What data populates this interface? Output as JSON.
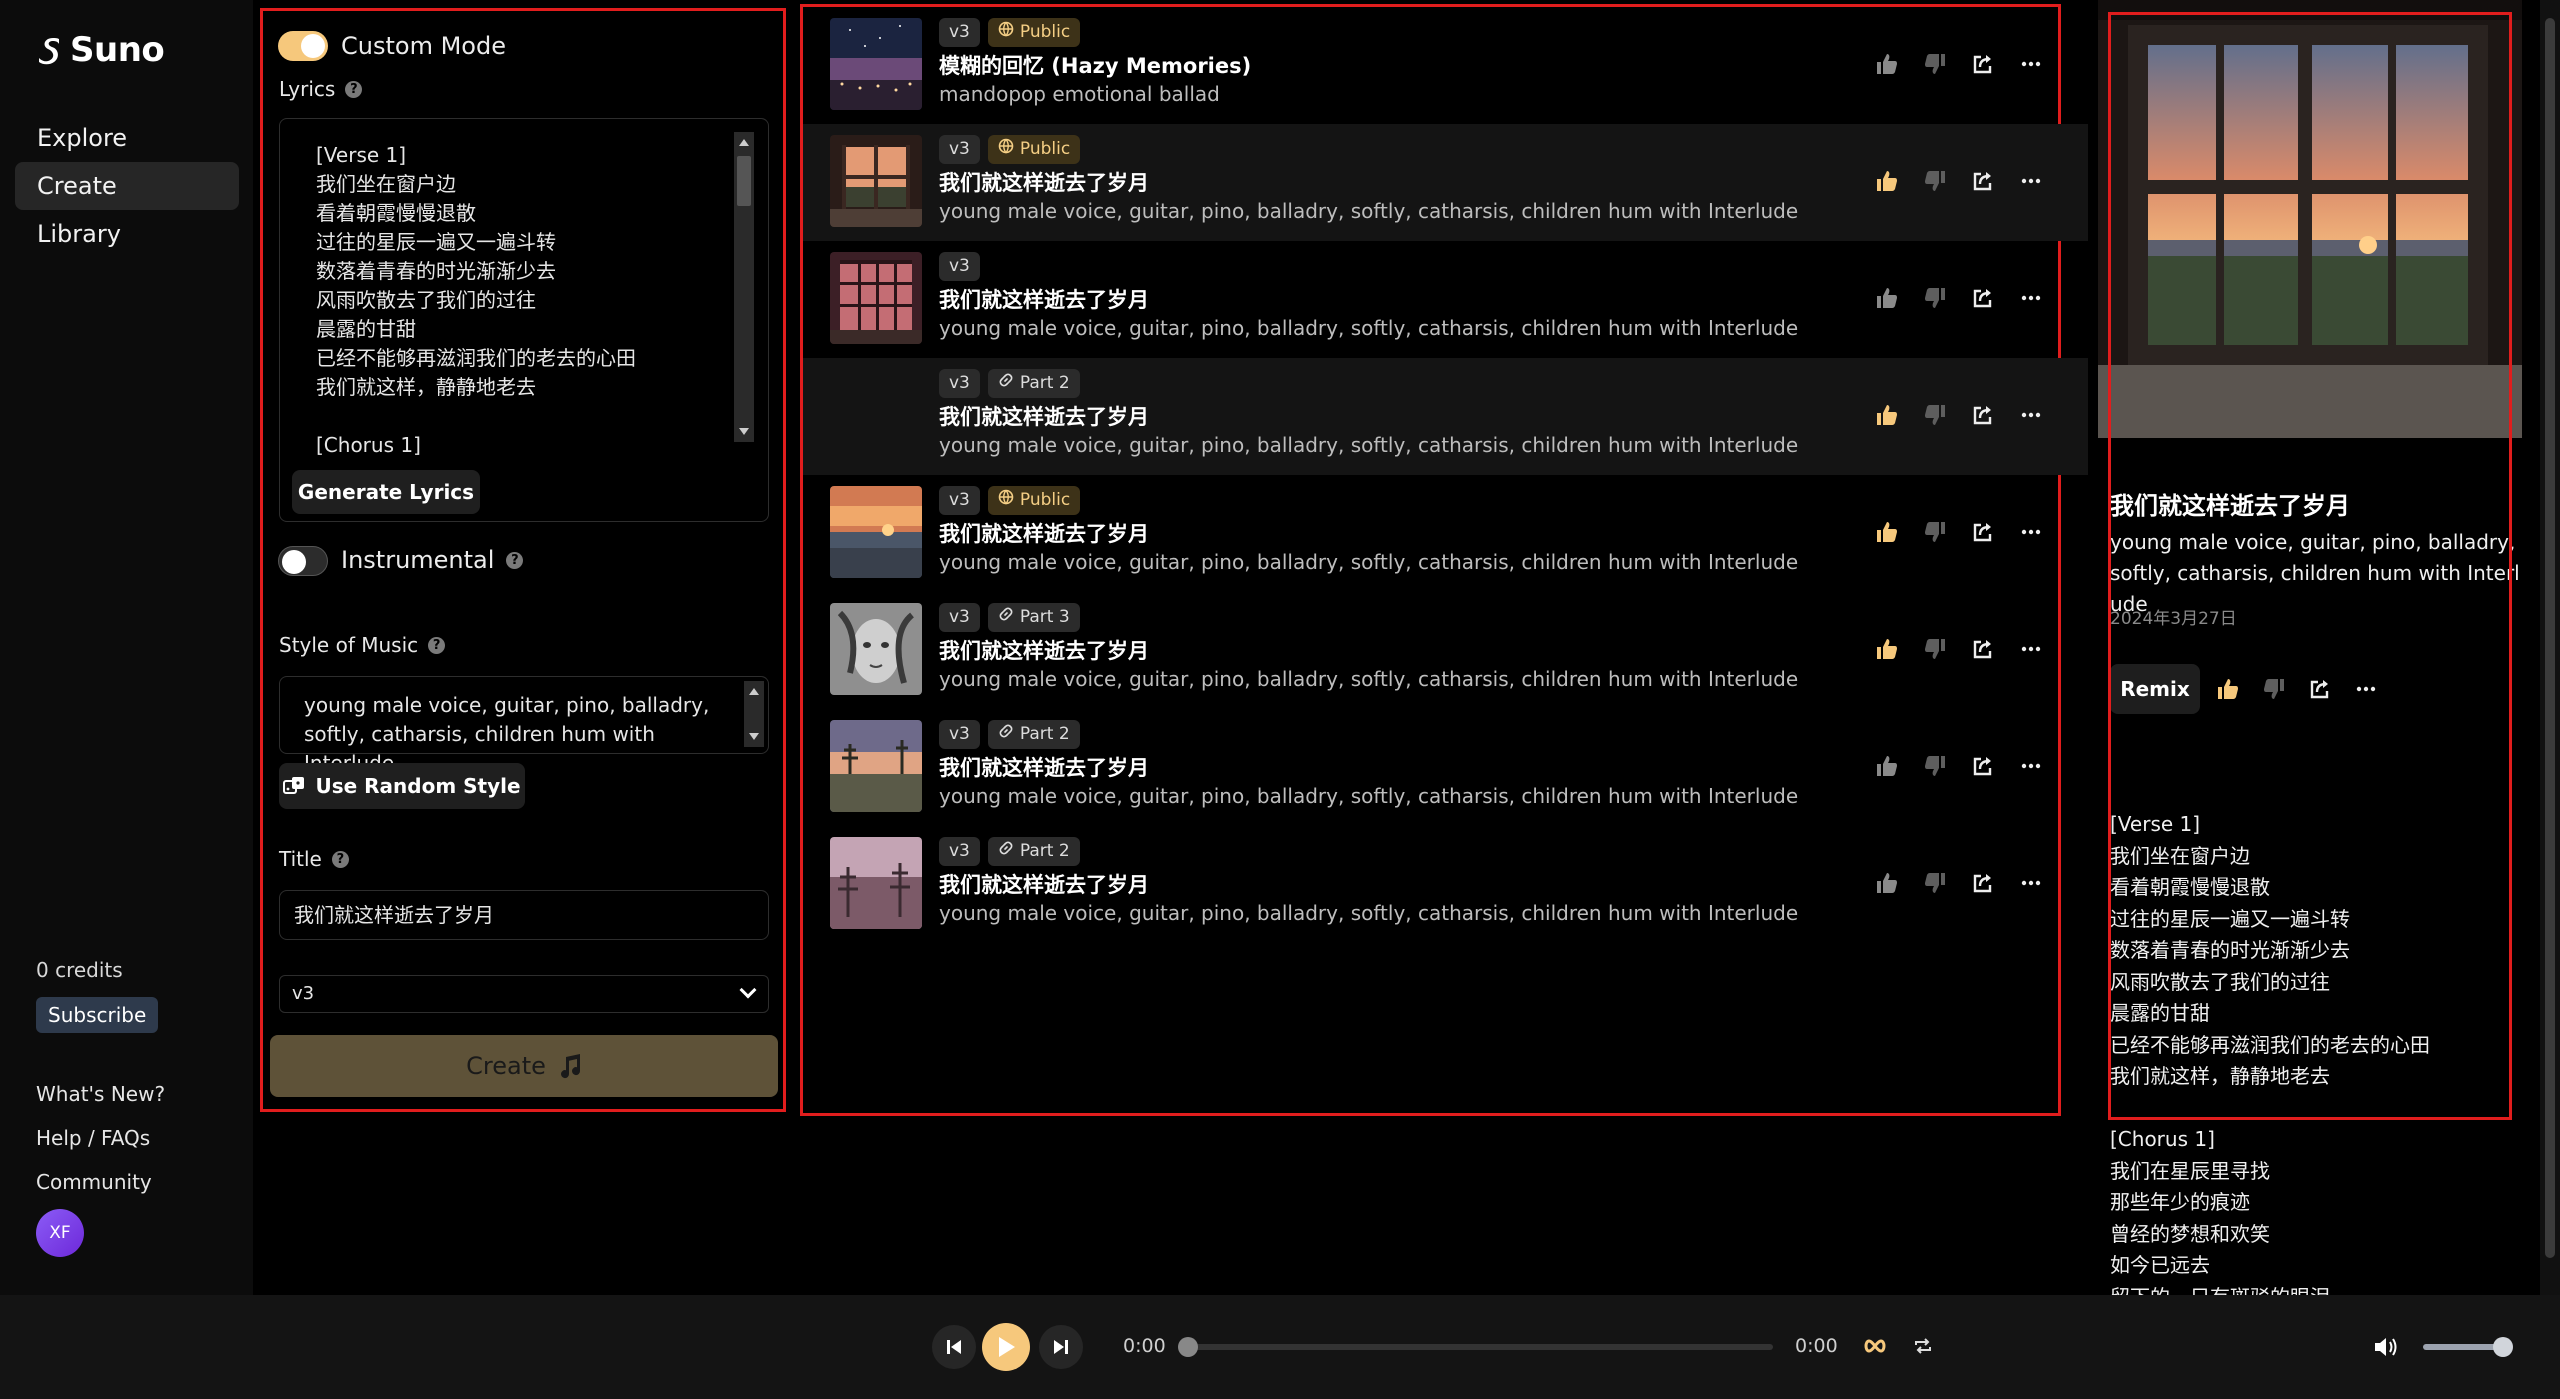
{
  "brand": {
    "name": "Suno"
  },
  "nav": [
    {
      "label": "Explore",
      "active": false
    },
    {
      "label": "Create",
      "active": true
    },
    {
      "label": "Library",
      "active": false
    }
  ],
  "account": {
    "credits": "0 credits",
    "subscribe_label": "Subscribe",
    "avatar_initials": "XF"
  },
  "footer_links": [
    "What's New?",
    "Help / FAQs",
    "Community"
  ],
  "create": {
    "custom_mode_label": "Custom Mode",
    "custom_mode_on": true,
    "lyrics_label": "Lyrics",
    "lyrics_lines": [
      "[Verse 1]",
      "我们坐在窗户边",
      "看着朝霞慢慢退散",
      "过往的星辰一遍又一遍斗转",
      "数落着青春的时光渐渐少去",
      "风雨吹散去了我们的过往",
      "晨露的甘甜",
      "已经不能够再滋润我们的老去的心田",
      "我们就这样，静静地老去",
      "",
      "[Chorus 1]"
    ],
    "generate_lyrics_label": "Generate Lyrics",
    "instrumental_label": "Instrumental",
    "instrumental_on": false,
    "style_label": "Style of Music",
    "style_value_lines": [
      "young male voice, guitar, pino, balladry,",
      "softly, catharsis, children hum with Interlude"
    ],
    "random_style_label": "Use Random Style",
    "title_label": "Title",
    "title_value": "我们就这样逝去了岁月",
    "version_value": "v3",
    "create_label": "Create"
  },
  "songs": [
    {
      "version": "v3",
      "tag": "Public",
      "tag_icon": "globe-icon",
      "title": "模糊的回忆 (Hazy Memories)",
      "style": "mandopop emotional ballad",
      "liked": false,
      "cover": "starry-city"
    },
    {
      "version": "v3",
      "tag": "Public",
      "tag_icon": "globe-icon",
      "title": "我们就这样逝去了岁月",
      "style": "young male voice, guitar, pino, balladry, softly, catharsis, children hum with Interlude",
      "liked": true,
      "cover": "window-sunset"
    },
    {
      "version": "v3",
      "tag": "",
      "tag_icon": "",
      "title": "我们就这样逝去了岁月",
      "style": "young male voice, guitar, pino, balladry, softly, catharsis, children hum with Interlude",
      "liked": false,
      "cover": "window-grid"
    },
    {
      "version": "v3",
      "tag": "Part 2",
      "tag_icon": "link-icon",
      "title": "我们就这样逝去了岁月",
      "style": "young male voice, guitar, pino, balladry, softly, catharsis, children hum with Interlude",
      "liked": true,
      "cover": "none"
    },
    {
      "version": "v3",
      "tag": "Public",
      "tag_icon": "globe-icon",
      "title": "我们就这样逝去了岁月",
      "style": "young male voice, guitar, pino, balladry, softly, catharsis, children hum with Interlude",
      "liked": true,
      "cover": "sea-sunset"
    },
    {
      "version": "v3",
      "tag": "Part 3",
      "tag_icon": "link-icon",
      "title": "我们就这样逝去了岁月",
      "style": "young male voice, guitar, pino, balladry, softly, catharsis, children hum with Interlude",
      "liked": true,
      "cover": "portrait"
    },
    {
      "version": "v3",
      "tag": "Part 2",
      "tag_icon": "link-icon",
      "title": "我们就这样逝去了岁月",
      "style": "young male voice, guitar, pino, balladry, softly, catharsis, children hum with Interlude",
      "liked": false,
      "cover": "dusk-trees"
    },
    {
      "version": "v3",
      "tag": "Part 2",
      "tag_icon": "link-icon",
      "title": "我们就这样逝去了岁月",
      "style": "young male voice, guitar, pino, balladry, softly, catharsis, children hum with Interlude",
      "liked": false,
      "cover": "pink-trees"
    }
  ],
  "detail": {
    "title": "我们就这样逝去了岁月",
    "style": "young male voice, guitar, pino, balladry, softly, catharsis, children hum with Interlude",
    "date": "2024年3月27日",
    "remix_label": "Remix",
    "lyrics_lines": [
      "[Verse 1]",
      "我们坐在窗户边",
      "看着朝霞慢慢退散",
      "过往的星辰一遍又一遍斗转",
      "数落着青春的时光渐渐少去",
      "风雨吹散去了我们的过往",
      "晨露的甘甜",
      "已经不能够再滋润我们的老去的心田",
      "我们就这样，静静地老去",
      "",
      "[Chorus 1]",
      "我们在星辰里寻找",
      "那些年少的痕迹",
      "曾经的梦想和欢笑",
      "如今已远去",
      "留下的，只有斑驳的眼泪"
    ]
  },
  "player": {
    "current_time": "0:00",
    "total_time": "0:00",
    "progress_fraction": 0,
    "volume_fraction": 1
  },
  "colors": {
    "accent": "#f6c87c",
    "highlight_border": "#e11d1d",
    "create_button": "#5e5238",
    "public_chip_bg": "#3d3218"
  }
}
